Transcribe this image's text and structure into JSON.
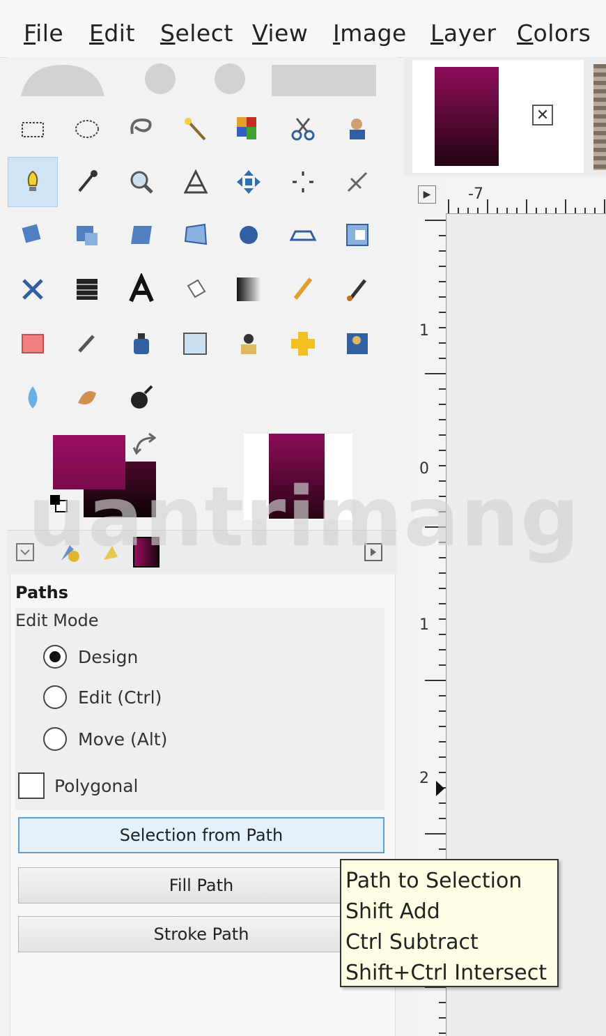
{
  "menubar": {
    "items": [
      {
        "first": "F",
        "rest": "ile"
      },
      {
        "first": "E",
        "rest": "dit"
      },
      {
        "first": "S",
        "rest": "elect"
      },
      {
        "first": "V",
        "rest": "iew"
      },
      {
        "first": "I",
        "rest": "mage"
      },
      {
        "first": "L",
        "rest": "ayer"
      },
      {
        "first": "C",
        "rest": "olors"
      }
    ]
  },
  "toolbox": {
    "rows": [
      [
        "rect-select-icon",
        "ellipse-select-icon",
        "free-select-icon",
        "fuzzy-select-icon",
        "color-select-icon",
        "scissors-select-icon",
        "foreground-select-icon"
      ],
      [
        "paths-icon",
        "color-picker-icon",
        "zoom-icon",
        "measure-icon",
        "move-icon",
        "alignment-icon",
        "crop-icon"
      ],
      [
        "rotate-icon",
        "scale-icon",
        "shear-icon",
        "perspective-icon",
        "transform-3d-icon",
        "flip-icon",
        "cage-icon"
      ],
      [
        "warp-icon",
        "handle-transform-icon",
        "text-icon",
        "bucket-fill-icon",
        "gradient-icon",
        "pencil-icon",
        "paintbrush-icon"
      ],
      [
        "eraser-icon",
        "airbrush-icon",
        "ink-icon",
        "mypaint-brush-icon",
        "clone-icon",
        "heal-icon",
        "perspective-clone-icon"
      ],
      [
        "blur-icon",
        "smudge-icon",
        "dodge-burn-icon"
      ]
    ],
    "active_tool": "paths-icon",
    "foreground_color": "#9b1060",
    "background_color": "#0d0206"
  },
  "tool_options": {
    "title": "Paths",
    "edit_mode_label": "Edit Mode",
    "modes": [
      {
        "label": "Design",
        "selected": true
      },
      {
        "label": "Edit (Ctrl)",
        "selected": false
      },
      {
        "label": "Move (Alt)",
        "selected": false
      }
    ],
    "polygonal_label": "Polygonal",
    "polygonal_checked": false,
    "buttons": {
      "selection_from_path": "Selection from Path",
      "fill_path": "Fill Path",
      "stroke_path": "Stroke Path"
    }
  },
  "tooltip": {
    "lines": [
      "Path to Selection",
      "Shift  Add",
      "Ctrl  Subtract",
      "Shift+Ctrl  Intersect"
    ]
  },
  "image_tab": {
    "close_label": "✕"
  },
  "rulers": {
    "horizontal_label": "-7",
    "vertical_labels": [
      "1",
      "0",
      "1",
      "2"
    ]
  },
  "watermark": {
    "text": "uantrimang"
  }
}
